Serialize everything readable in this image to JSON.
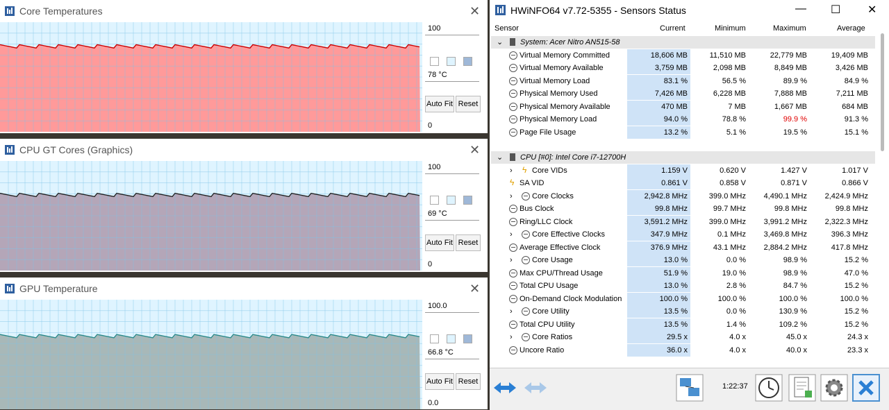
{
  "graph_windows": [
    {
      "title": "Core Temperatures",
      "max": "100",
      "current": "78 °C",
      "min": "0",
      "auto_fit": "Auto Fit",
      "reset": "Reset",
      "fill": "#ff9a9a",
      "line": "#cc0000",
      "bg": "#dff4ff",
      "level": 0.78
    },
    {
      "title": "CPU GT Cores (Graphics)",
      "max": "100",
      "current": "69 °C",
      "min": "0",
      "auto_fit": "Auto Fit",
      "reset": "Reset",
      "fill": "#b4a6b8",
      "line": "#222222",
      "bg": "#dff4ff",
      "level": 0.69
    },
    {
      "title": "GPU Temperature",
      "max": "100.0",
      "current": "66.8 °C",
      "min": "0.0",
      "auto_fit": "Auto Fit",
      "reset": "Reset",
      "fill": "#a8b8b8",
      "line": "#2a8a8a",
      "bg": "#dff4ff",
      "level": 0.668
    }
  ],
  "hwinfo": {
    "title": "HWiNFO64 v7.72-5355 - Sensors Status",
    "columns": {
      "sensor": "Sensor",
      "current": "Current",
      "minimum": "Minimum",
      "maximum": "Maximum",
      "average": "Average"
    },
    "rows": [
      {
        "type": "group",
        "label": "System: Acer Nitro AN515-58"
      },
      {
        "type": "item",
        "icon": "circle",
        "label": "Virtual Memory Committed",
        "current": "18,606 MB",
        "min": "11,510 MB",
        "max": "22,779 MB",
        "avg": "19,409 MB"
      },
      {
        "type": "item",
        "icon": "circle",
        "label": "Virtual Memory Available",
        "current": "3,759 MB",
        "min": "2,098 MB",
        "max": "8,849 MB",
        "avg": "3,426 MB"
      },
      {
        "type": "item",
        "icon": "circle",
        "label": "Virtual Memory Load",
        "current": "83.1 %",
        "min": "56.5 %",
        "max": "89.9 %",
        "avg": "84.9 %"
      },
      {
        "type": "item",
        "icon": "circle",
        "label": "Physical Memory Used",
        "current": "7,426 MB",
        "min": "6,228 MB",
        "max": "7,888 MB",
        "avg": "7,211 MB"
      },
      {
        "type": "item",
        "icon": "circle",
        "label": "Physical Memory Available",
        "current": "470 MB",
        "min": "7 MB",
        "max": "1,667 MB",
        "avg": "684 MB"
      },
      {
        "type": "item",
        "icon": "circle",
        "label": "Physical Memory Load",
        "current": "94.0 %",
        "min": "78.8 %",
        "max": "99.9 %",
        "avg": "91.3 %",
        "max_color": "#e00000"
      },
      {
        "type": "item",
        "icon": "circle",
        "label": "Page File Usage",
        "current": "13.2 %",
        "min": "5.1 %",
        "max": "19.5 %",
        "avg": "15.1 %"
      },
      {
        "type": "spacer"
      },
      {
        "type": "group",
        "label": "CPU [#0]: Intel Core i7-12700H"
      },
      {
        "type": "item",
        "icon": "bolt",
        "expand": true,
        "label": "Core VIDs",
        "current": "1.159 V",
        "min": "0.620 V",
        "max": "1.427 V",
        "avg": "1.017 V"
      },
      {
        "type": "item",
        "icon": "bolt",
        "label": "SA VID",
        "current": "0.861 V",
        "min": "0.858 V",
        "max": "0.871 V",
        "avg": "0.866 V"
      },
      {
        "type": "item",
        "icon": "circle",
        "expand": true,
        "label": "Core Clocks",
        "current": "2,942.8 MHz",
        "min": "399.0 MHz",
        "max": "4,490.1 MHz",
        "avg": "2,424.9 MHz"
      },
      {
        "type": "item",
        "icon": "circle",
        "label": "Bus Clock",
        "current": "99.8 MHz",
        "min": "99.7 MHz",
        "max": "99.8 MHz",
        "avg": "99.8 MHz"
      },
      {
        "type": "item",
        "icon": "circle",
        "label": "Ring/LLC Clock",
        "current": "3,591.2 MHz",
        "min": "399.0 MHz",
        "max": "3,991.2 MHz",
        "avg": "2,322.3 MHz"
      },
      {
        "type": "item",
        "icon": "circle",
        "expand": true,
        "label": "Core Effective Clocks",
        "current": "347.9 MHz",
        "min": "0.1 MHz",
        "max": "3,469.8 MHz",
        "avg": "396.3 MHz"
      },
      {
        "type": "item",
        "icon": "circle",
        "label": "Average Effective Clock",
        "current": "376.9 MHz",
        "min": "43.1 MHz",
        "max": "2,884.2 MHz",
        "avg": "417.8 MHz"
      },
      {
        "type": "item",
        "icon": "circle",
        "expand": true,
        "label": "Core Usage",
        "current": "13.0 %",
        "min": "0.0 %",
        "max": "98.9 %",
        "avg": "15.2 %"
      },
      {
        "type": "item",
        "icon": "circle",
        "label": "Max CPU/Thread Usage",
        "current": "51.9 %",
        "min": "19.0 %",
        "max": "98.9 %",
        "avg": "47.0 %"
      },
      {
        "type": "item",
        "icon": "circle",
        "label": "Total CPU Usage",
        "current": "13.0 %",
        "min": "2.8 %",
        "max": "84.7 %",
        "avg": "15.2 %"
      },
      {
        "type": "item",
        "icon": "circle",
        "label": "On-Demand Clock Modulation",
        "current": "100.0 %",
        "min": "100.0 %",
        "max": "100.0 %",
        "avg": "100.0 %"
      },
      {
        "type": "item",
        "icon": "circle",
        "expand": true,
        "label": "Core Utility",
        "current": "13.5 %",
        "min": "0.0 %",
        "max": "130.9 %",
        "avg": "15.2 %"
      },
      {
        "type": "item",
        "icon": "circle",
        "label": "Total CPU Utility",
        "current": "13.5 %",
        "min": "1.4 %",
        "max": "109.2 %",
        "avg": "15.2 %"
      },
      {
        "type": "item",
        "icon": "circle",
        "expand": true,
        "label": "Core Ratios",
        "current": "29.5 x",
        "min": "4.0 x",
        "max": "45.0 x",
        "avg": "24.3 x"
      },
      {
        "type": "item",
        "icon": "circle",
        "label": "Uncore Ratio",
        "current": "36.0 x",
        "min": "4.0 x",
        "max": "40.0 x",
        "avg": "23.3 x"
      }
    ],
    "uptime": "1:22:37"
  }
}
